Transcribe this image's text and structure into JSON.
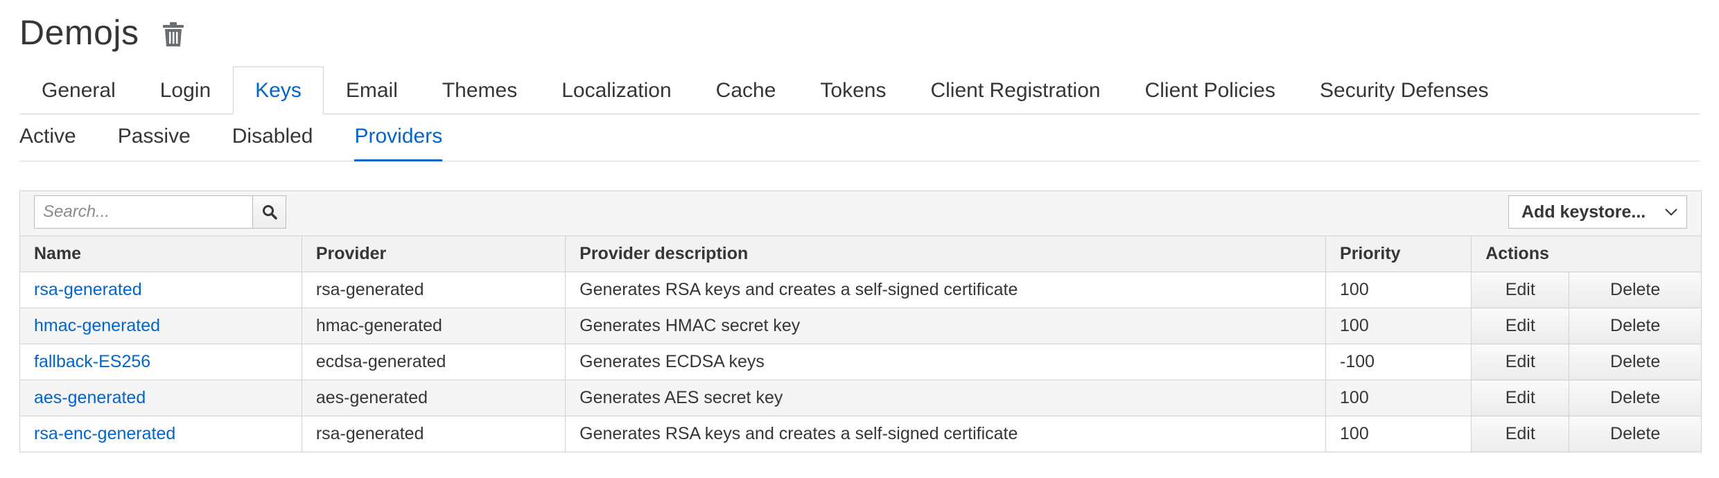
{
  "page": {
    "title": "Demojs",
    "delete_icon": "trash-icon"
  },
  "main_tabs": [
    {
      "label": "General",
      "active": false
    },
    {
      "label": "Login",
      "active": false
    },
    {
      "label": "Keys",
      "active": true
    },
    {
      "label": "Email",
      "active": false
    },
    {
      "label": "Themes",
      "active": false
    },
    {
      "label": "Localization",
      "active": false
    },
    {
      "label": "Cache",
      "active": false
    },
    {
      "label": "Tokens",
      "active": false
    },
    {
      "label": "Client Registration",
      "active": false
    },
    {
      "label": "Client Policies",
      "active": false
    },
    {
      "label": "Security Defenses",
      "active": false
    }
  ],
  "sub_tabs": [
    {
      "label": "Active",
      "active": false
    },
    {
      "label": "Passive",
      "active": false
    },
    {
      "label": "Disabled",
      "active": false
    },
    {
      "label": "Providers",
      "active": true
    }
  ],
  "toolbar": {
    "search_placeholder": "Search...",
    "search_value": "",
    "search_icon": "search-icon",
    "add_keystore_label": "Add keystore...",
    "add_keystore_icon": "chevron-down-icon"
  },
  "table": {
    "columns": {
      "name": "Name",
      "provider": "Provider",
      "description": "Provider description",
      "priority": "Priority",
      "actions": "Actions"
    },
    "rows": [
      {
        "name": "rsa-generated",
        "provider": "rsa-generated",
        "description": "Generates RSA keys and creates a self-signed certificate",
        "priority": "100",
        "edit": "Edit",
        "delete": "Delete"
      },
      {
        "name": "hmac-generated",
        "provider": "hmac-generated",
        "description": "Generates HMAC secret key",
        "priority": "100",
        "edit": "Edit",
        "delete": "Delete"
      },
      {
        "name": "fallback-ES256",
        "provider": "ecdsa-generated",
        "description": "Generates ECDSA keys",
        "priority": "-100",
        "edit": "Edit",
        "delete": "Delete"
      },
      {
        "name": "aes-generated",
        "provider": "aes-generated",
        "description": "Generates AES secret key",
        "priority": "100",
        "edit": "Edit",
        "delete": "Delete"
      },
      {
        "name": "rsa-enc-generated",
        "provider": "rsa-generated",
        "description": "Generates RSA keys and creates a self-signed certificate",
        "priority": "100",
        "edit": "Edit",
        "delete": "Delete"
      }
    ]
  },
  "colors": {
    "accent": "#0066cc",
    "text": "#363636",
    "border": "#d1d1d1",
    "header_bg": "#f2f2f2"
  }
}
